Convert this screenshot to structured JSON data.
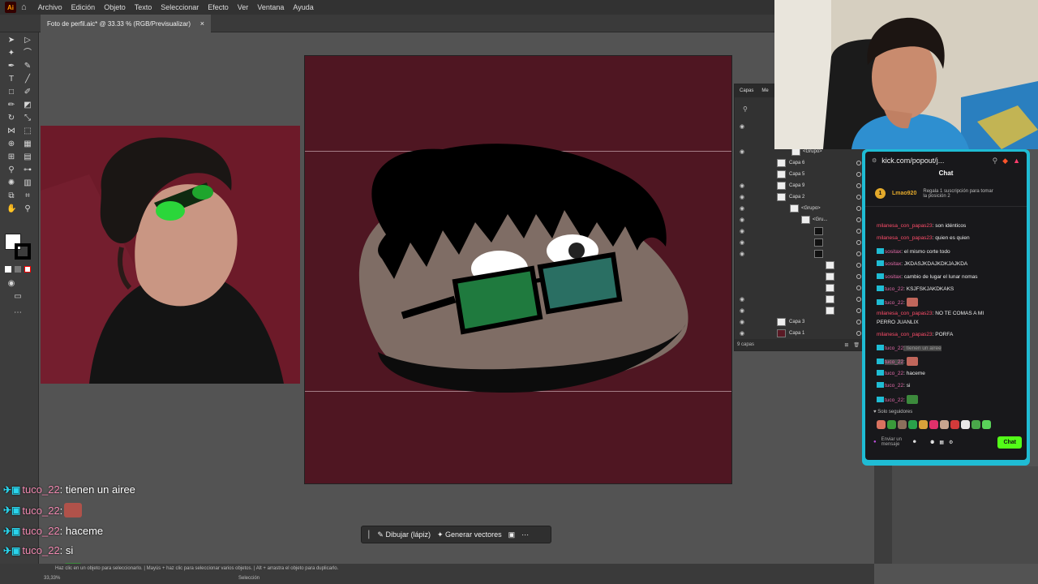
{
  "menubar": {
    "items": [
      "Archivo",
      "Edición",
      "Objeto",
      "Texto",
      "Seleccionar",
      "Efecto",
      "Ver",
      "Ventana",
      "Ayuda"
    ]
  },
  "document_tab": {
    "title": "Foto de perfil.aic* @ 33.33 % (RGB/Previsualizar)",
    "close": "×"
  },
  "layers_panel": {
    "tabs": [
      "Capas",
      "Me"
    ],
    "rows": [
      {
        "name": "<Grupo>",
        "indent": 2
      },
      {
        "name": "Capa 6",
        "indent": 0
      },
      {
        "name": "Capa 5",
        "indent": 0
      },
      {
        "name": "Capa 9",
        "indent": 0
      },
      {
        "name": "Capa 2",
        "indent": 0
      },
      {
        "name": "<Grupo>",
        "indent": 1
      },
      {
        "name": "<Gru...",
        "indent": 2
      },
      {
        "name": "Capa 3",
        "indent": 0
      },
      {
        "name": "Capa 1",
        "indent": 0
      }
    ],
    "count": "9 capas"
  },
  "context_bar": {
    "draw_label": "Dibujar (lápiz)",
    "vectorize_label": "Generar vectores"
  },
  "statusbar": {
    "zoom": "33,33%",
    "tool": "Selección",
    "hint": "Haz clic en un objeto para seleccionarlo. | Mayús + haz clic para seleccionar varios objetos. | Alt + arrastra el objeto para duplicarlo."
  },
  "kick": {
    "url": "kick.com/popout/j...",
    "title": "Chat",
    "pinned_user": "Lmao920",
    "pinned_count": "1",
    "pinned_text": "Regala 1 suscripción para tomar la posición 2",
    "messages": [
      {
        "user": "milanesa_con_papas23",
        "text": ": son idénticos",
        "color": "red"
      },
      {
        "user": "milanesa_con_papas23",
        "text": ": quien es quien",
        "color": "red"
      },
      {
        "user": "sositax",
        "text": ": el mismo corte todo",
        "color": "pink"
      },
      {
        "user": "sositax",
        "text": ": JKDASJKDAJKDKJAJKDA",
        "color": "pink"
      },
      {
        "user": "sositax",
        "text": ": cambio de lugar el lunar nomas",
        "color": "pink"
      },
      {
        "user": "tuco_22",
        "text": ": KSJFSKJAKDKAKS",
        "color": "pink"
      },
      {
        "user": "tuco_22",
        "text": ": ",
        "color": "pink",
        "emote": true
      },
      {
        "user": "milanesa_con_papas23",
        "text": ": NO TE COMAS A MI",
        "color": "red"
      },
      {
        "user": "",
        "text": "PERRO JUANLIX",
        "color": "red"
      },
      {
        "user": "milanesa_con_papas23",
        "text": ": PORFA",
        "color": "red"
      },
      {
        "user": "tuco_22",
        "text": ": tienen un airee",
        "color": "pink"
      },
      {
        "user": "tuco_22",
        "text": ": ",
        "color": "pink",
        "emote": true
      },
      {
        "user": "tuco_22",
        "text": ": haceme",
        "color": "pink"
      },
      {
        "user": "tuco_22",
        "text": ": si",
        "color": "pink"
      },
      {
        "user": "tuco_22",
        "text": ": ",
        "color": "pink",
        "emote": true
      }
    ],
    "followers_only": "Solo seguidores",
    "input_placeholder": "Enviar un mensaje",
    "chat_button": "Chat"
  },
  "overlay_chat": [
    {
      "user": "tuco_22",
      "text": ": tienen un airee",
      "emote": false
    },
    {
      "user": "tuco_22",
      "text": ": ",
      "emote": true
    },
    {
      "user": "tuco_22",
      "text": ": haceme",
      "emote": false
    },
    {
      "user": "tuco_22",
      "text": ": si",
      "emote": false
    },
    {
      "user": "tuco_22",
      "text": ": ",
      "emote": true
    }
  ],
  "colors": {
    "artboard": "#4f1622",
    "kick_accent": "#1fbcd4",
    "kick_green": "#53fc18",
    "username_pink": "#f28ab2"
  }
}
